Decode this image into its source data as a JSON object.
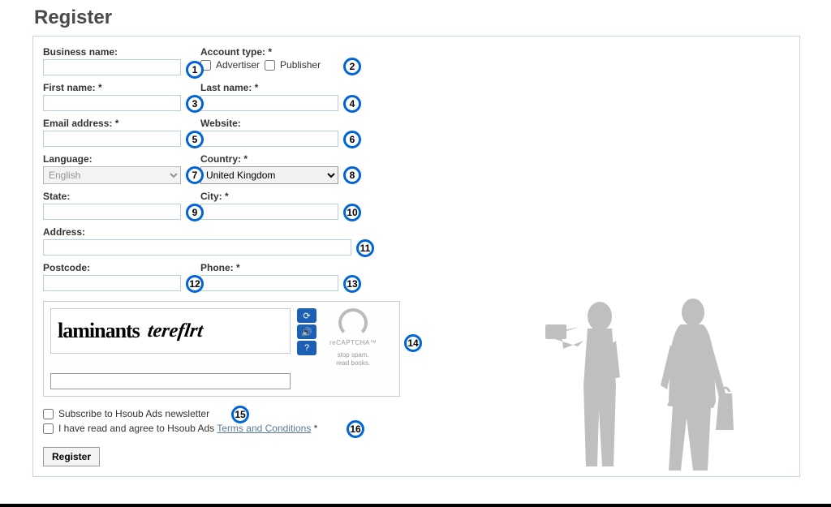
{
  "title": "Register",
  "labels": {
    "business_name": "Business name:",
    "account_type": "Account type: *",
    "advertiser": "Advertiser",
    "publisher": "Publisher",
    "first_name": "First name: *",
    "last_name": "Last name: *",
    "email": "Email address: *",
    "website": "Website:",
    "language": "Language:",
    "country": "Country: *",
    "state": "State:",
    "city": "City: *",
    "address": "Address:",
    "postcode": "Postcode:",
    "phone": "Phone: *"
  },
  "values": {
    "language": "English",
    "country": "United Kingdom"
  },
  "captcha": {
    "word1": "laminants",
    "word2": "tereflrt",
    "brand": "reCAPTCHA™",
    "tag1": "stop spam.",
    "tag2": "read books."
  },
  "checks": {
    "newsletter": "Subscribe to Hsoub Ads newsletter",
    "terms_pre": "I have read and agree to Hsoub Ads ",
    "terms_link": "Terms and Conditions",
    "terms_suf": " *"
  },
  "buttons": {
    "register": "Register"
  },
  "badges": [
    "1",
    "2",
    "3",
    "4",
    "5",
    "6",
    "7",
    "8",
    "9",
    "10",
    "11",
    "12",
    "13",
    "14",
    "15",
    "16"
  ]
}
